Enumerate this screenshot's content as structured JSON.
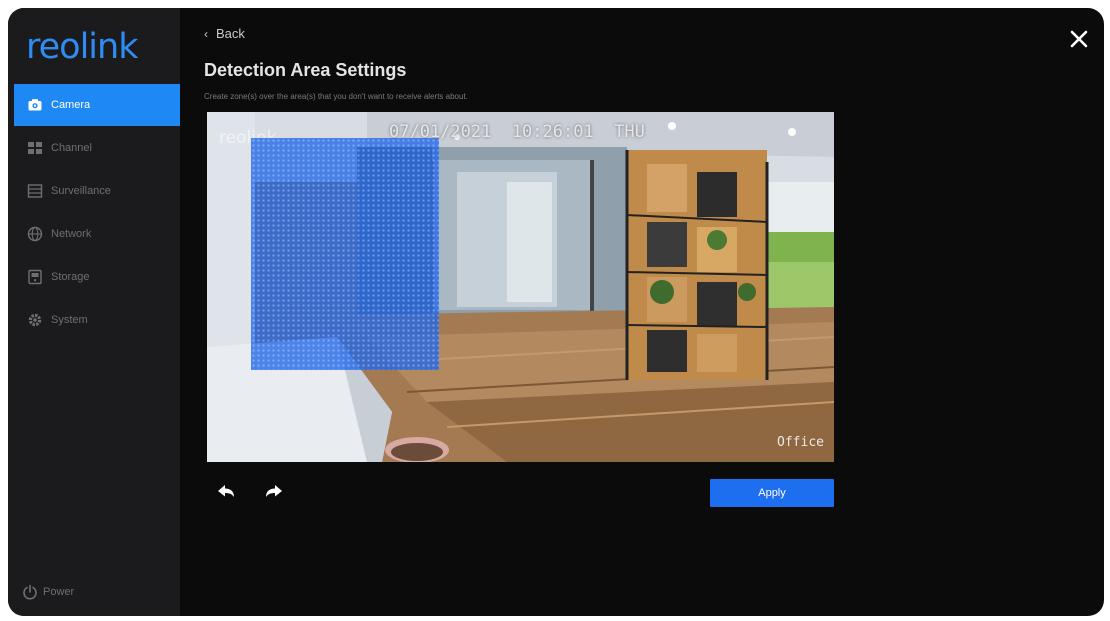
{
  "app": {
    "logo": "reolink"
  },
  "sidebar": {
    "items": [
      {
        "label": "Camera",
        "icon": "camera-icon",
        "active": true
      },
      {
        "label": "Channel",
        "icon": "channel-icon",
        "active": false
      },
      {
        "label": "Surveillance",
        "icon": "surveillance-icon",
        "active": false
      },
      {
        "label": "Network",
        "icon": "network-icon",
        "active": false
      },
      {
        "label": "Storage",
        "icon": "storage-icon",
        "active": false
      },
      {
        "label": "System",
        "icon": "system-icon",
        "active": false
      }
    ],
    "power_label": "Power"
  },
  "header": {
    "back_label": "Back",
    "title": "Detection Area Settings",
    "description": "Create zone(s) over the area(s) that you don't want to receive alerts about."
  },
  "camera": {
    "timestamp": "07/01/2021  10:26:01  THU",
    "watermark": "reolink",
    "channel_label": "Office"
  },
  "toolbar": {
    "tools": [
      {
        "name": "undo-button",
        "icon": "undo-icon"
      },
      {
        "name": "redo-button",
        "icon": "redo-icon"
      }
    ],
    "apply_label": "Apply"
  },
  "colors": {
    "accent": "#1e88f5",
    "button": "#1e6ff0",
    "background": "#0b0b0c",
    "sidebar": "#1b1b1e",
    "mask": "#2166e8"
  }
}
